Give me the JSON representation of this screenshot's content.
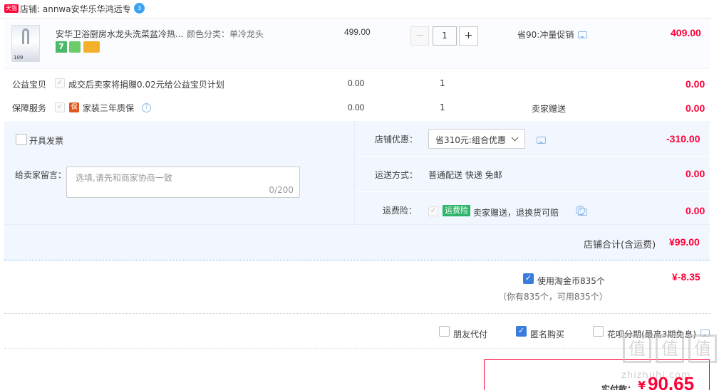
{
  "shop": {
    "tmall_badge": "天猫",
    "name": "店铺: annwa安华乐华鸿远专",
    "ww_label": "3"
  },
  "item": {
    "title": "安华卫浴厨房水龙头洗菜盆冷热...",
    "sku": "颜色分类：单冷龙头",
    "thumb_text": "109",
    "badge_7": "7",
    "unit_price": "499.00",
    "qty": "1",
    "qty_minus": "−",
    "qty_plus": "+",
    "promo": "省90:冲量促销",
    "subtotal": "409.00"
  },
  "charity": {
    "label": "公益宝贝",
    "desc": "成交后卖家将捐赠0.02元给公益宝贝计划",
    "price": "0.00",
    "qty": "1",
    "subtotal": "0.00"
  },
  "service": {
    "label": "保障服务",
    "badge": "保",
    "desc": "家装三年质保",
    "price": "0.00",
    "qty": "1",
    "note": "卖家赠送",
    "subtotal": "0.00"
  },
  "invoice": {
    "label": "开具发票"
  },
  "shop_discount": {
    "label": "店铺优惠：",
    "selected": "省310元:组合优惠",
    "amount": "-310.00"
  },
  "message": {
    "label": "给卖家留言：",
    "placeholder": "选填,请先和商家协商一致",
    "counter": "0/200"
  },
  "delivery": {
    "label": "运送方式：",
    "value": "普通配送 快递 免邮",
    "amount": "0.00"
  },
  "insurance": {
    "label": "运费险：",
    "tag": "运费险",
    "desc": "卖家赠送，退换货可赔",
    "amount": "0.00"
  },
  "shop_total": {
    "label": "店铺合计(含运费)",
    "amount": "¥99.00"
  },
  "taojinbi": {
    "label": "使用淘金币835个",
    "sub": "（你有835个，可用835个）",
    "amount": "¥-8.35"
  },
  "options": {
    "friend_pay": "朋友代付",
    "anonymous": "匿名购买",
    "huabei": "花呗分期(最高3期免息)"
  },
  "pay": {
    "label": "实付款：",
    "currency": "¥",
    "amount": "90.65"
  },
  "watermark": {
    "logo": "值",
    "site": "zhizhuhi.com"
  },
  "colors": {
    "accent_red": "#ff0036",
    "panel_blue": "#f2f7ff",
    "border_blue": "#b2d1ff",
    "check_blue": "#3b7ddd",
    "tag_green": "#2fb56a"
  }
}
